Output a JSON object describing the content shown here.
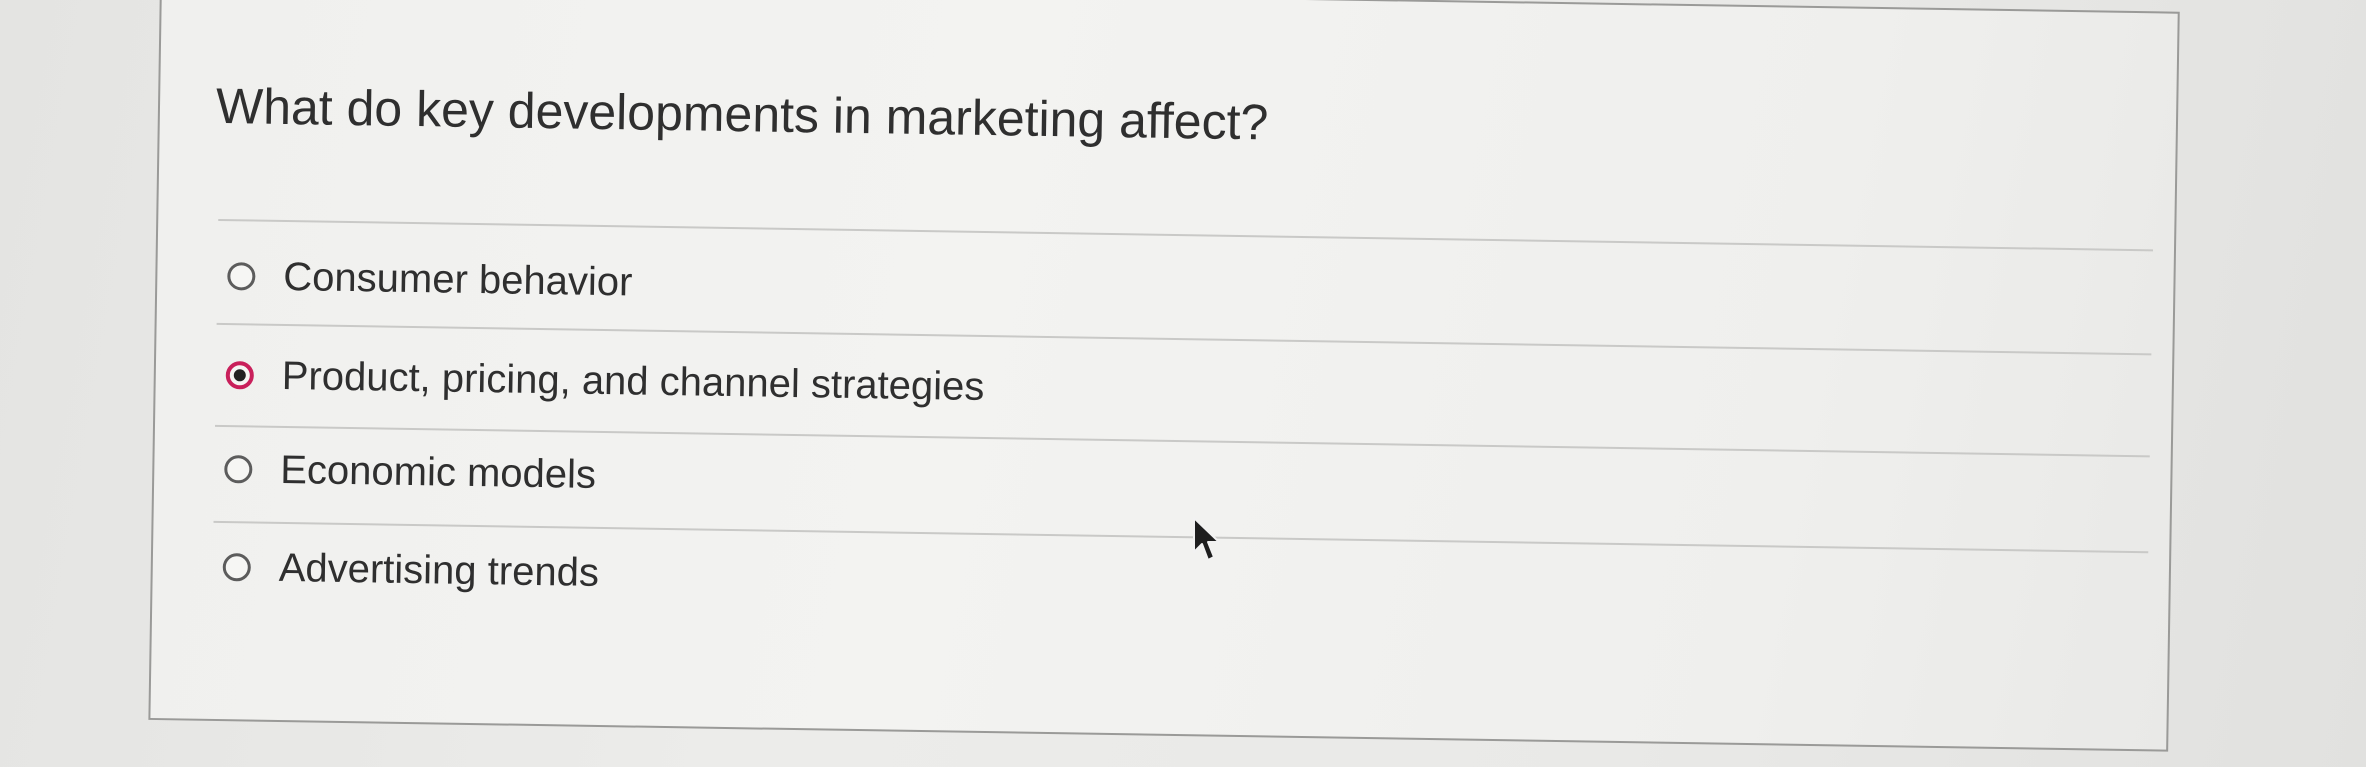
{
  "question": {
    "text": "What do key developments in marketing affect?"
  },
  "options": [
    {
      "label": "Consumer behavior",
      "selected": false
    },
    {
      "label": "Product, pricing, and channel strategies",
      "selected": true
    },
    {
      "label": "Economic models",
      "selected": false
    },
    {
      "label": "Advertising trends",
      "selected": false
    }
  ],
  "colors": {
    "selected_ring": "#c9205b",
    "text": "#2f2f2f"
  },
  "icons": {
    "pointer": "mouse-pointer-icon"
  }
}
